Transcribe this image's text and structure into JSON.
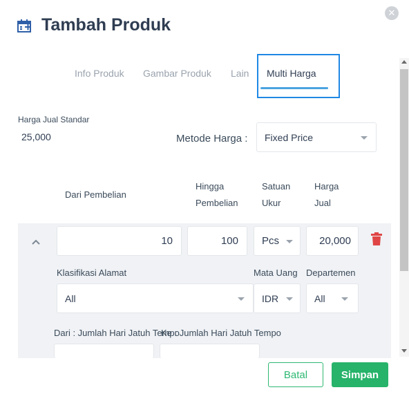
{
  "header": {
    "title": "Tambah Produk",
    "icon": "calendar-add-icon"
  },
  "tabs": [
    {
      "label": "Info Produk",
      "active": false
    },
    {
      "label": "Gambar Produk",
      "active": false
    },
    {
      "label": "Lain",
      "active": false
    },
    {
      "label": "Multi Harga",
      "active": true
    }
  ],
  "colors": {
    "accent": "#27b36a",
    "tab_focus": "#1e88e5",
    "trash": "#e04545"
  },
  "price": {
    "standard_label": "Harga Jual Standar",
    "standard_value": "25,000",
    "method_label": "Metode Harga :",
    "method_value": "Fixed Price"
  },
  "table_headers": {
    "from": "Dari Pembelian",
    "to_line1": "Hingga",
    "to_line2": "Pembelian",
    "unit_line1": "Satuan",
    "unit_line2": "Ukur",
    "price_line1": "Harga",
    "price_line2": "Jual"
  },
  "row": {
    "from": "10",
    "to": "100",
    "unit": "Pcs",
    "price": "20,000",
    "address_label": "Klasifikasi Alamat",
    "address_value": "All",
    "currency_label": "Mata Uang",
    "currency_value": "IDR",
    "department_label": "Departemen",
    "department_value": "All",
    "due_from_label": "Dari : Jumlah Hari Jatuh Tempo",
    "due_to_label": "Ke : Jumlah Hari Jatuh Tempo"
  },
  "footer": {
    "cancel": "Batal",
    "save": "Simpan"
  }
}
